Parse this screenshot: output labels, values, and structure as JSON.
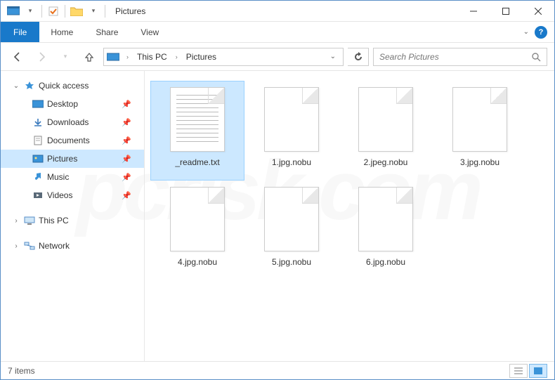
{
  "window": {
    "title": "Pictures"
  },
  "ribbon": {
    "file": "File",
    "tabs": [
      "Home",
      "Share",
      "View"
    ]
  },
  "breadcrumbs": [
    "This PC",
    "Pictures"
  ],
  "search": {
    "placeholder": "Search Pictures"
  },
  "sidebar": {
    "quick_access": "Quick access",
    "items": [
      {
        "label": "Desktop",
        "icon": "desktop"
      },
      {
        "label": "Downloads",
        "icon": "downloads"
      },
      {
        "label": "Documents",
        "icon": "documents"
      },
      {
        "label": "Pictures",
        "icon": "pictures",
        "selected": true
      },
      {
        "label": "Music",
        "icon": "music"
      },
      {
        "label": "Videos",
        "icon": "videos"
      }
    ],
    "this_pc": "This PC",
    "network": "Network"
  },
  "files": [
    {
      "name": "_readme.txt",
      "type": "txt",
      "selected": true
    },
    {
      "name": "1.jpg.nobu",
      "type": "blank"
    },
    {
      "name": "2.jpeg.nobu",
      "type": "blank"
    },
    {
      "name": "3.jpg.nobu",
      "type": "blank"
    },
    {
      "name": "4.jpg.nobu",
      "type": "blank"
    },
    {
      "name": "5.jpg.nobu",
      "type": "blank"
    },
    {
      "name": "6.jpg.nobu",
      "type": "blank"
    }
  ],
  "status": {
    "count_text": "7 items"
  }
}
